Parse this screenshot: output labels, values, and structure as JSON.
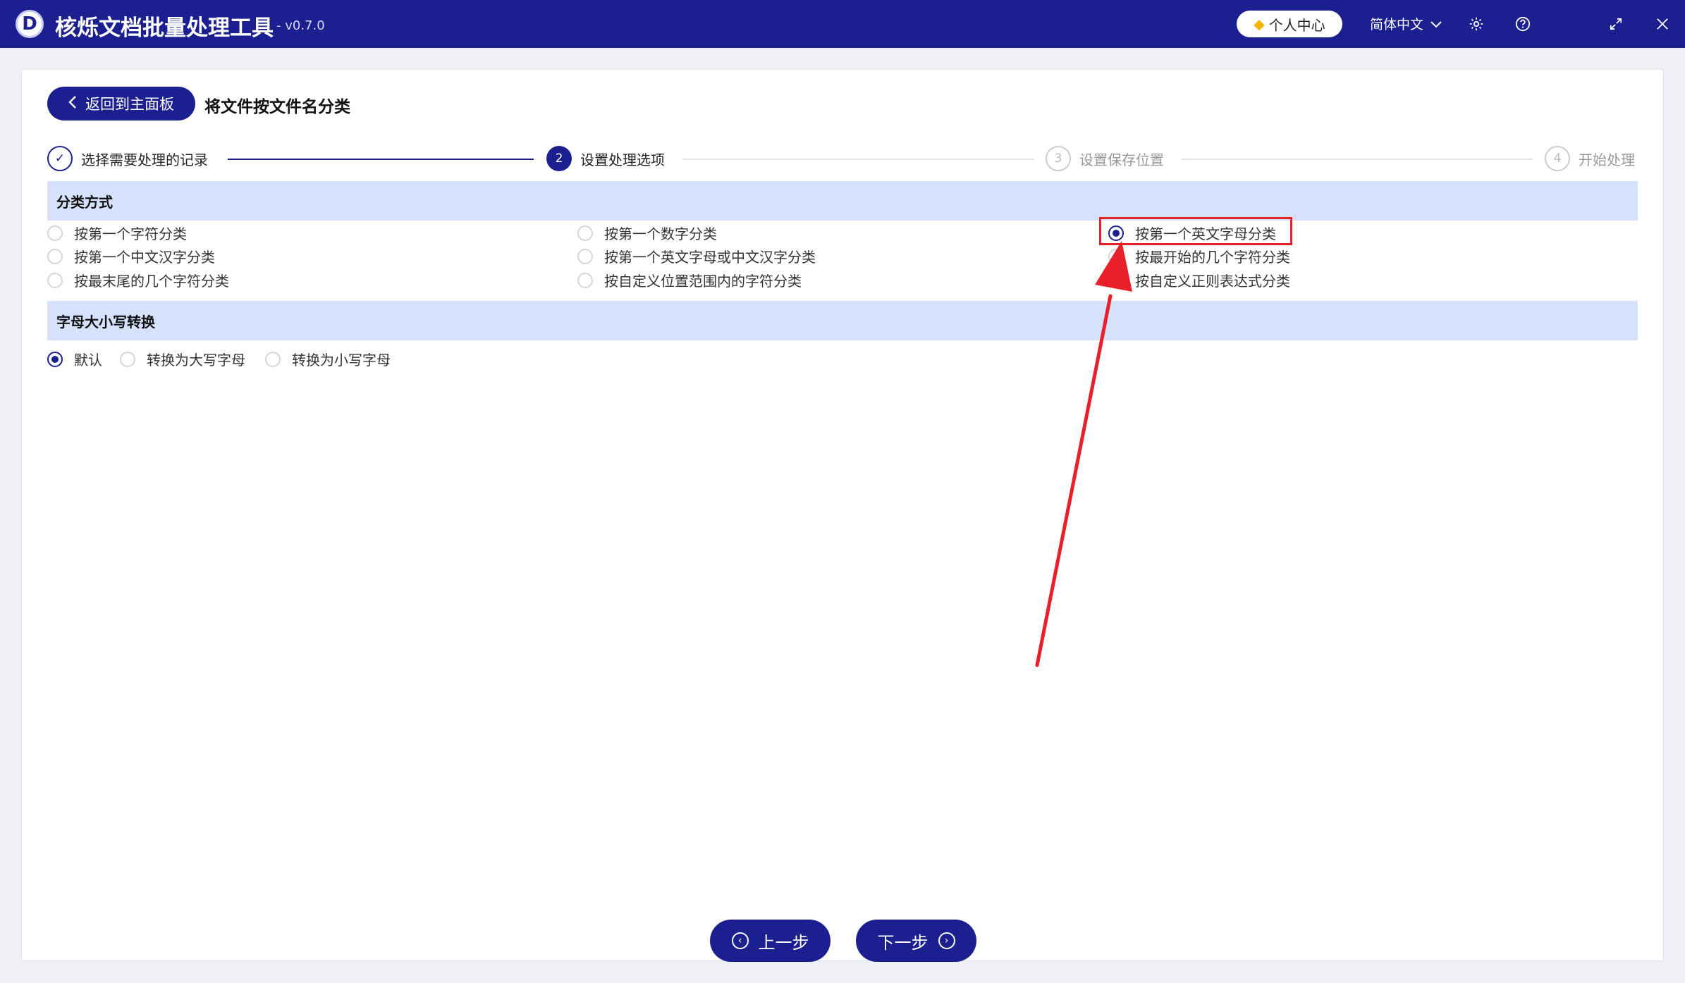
{
  "app": {
    "logo_letter": "D",
    "title": "核烁文档批量处理工具",
    "version": "- v0.7.0",
    "personal_center": "个人中心",
    "language": "简体中文"
  },
  "header": {
    "back_label": "返回到主面板",
    "page_title": "将文件按文件名分类"
  },
  "steps": [
    {
      "num": "✓",
      "label": "选择需要处理的记录",
      "state": "done"
    },
    {
      "num": "2",
      "label": "设置处理选项",
      "state": "active"
    },
    {
      "num": "3",
      "label": "设置保存位置",
      "state": "pending"
    },
    {
      "num": "4",
      "label": "开始处理",
      "state": "pending"
    }
  ],
  "classification": {
    "heading": "分类方式",
    "options": [
      {
        "label": "按第一个字符分类",
        "checked": false
      },
      {
        "label": "按第一个数字分类",
        "checked": false
      },
      {
        "label": "按第一个英文字母分类",
        "checked": true
      },
      {
        "label": "按第一个中文汉字分类",
        "checked": false
      },
      {
        "label": "按第一个英文字母或中文汉字分类",
        "checked": false
      },
      {
        "label": "按最开始的几个字符分类",
        "checked": false
      },
      {
        "label": "按最末尾的几个字符分类",
        "checked": false
      },
      {
        "label": "按自定义位置范围内的字符分类",
        "checked": false
      },
      {
        "label": "按自定义正则表达式分类",
        "checked": false
      }
    ]
  },
  "case_conversion": {
    "heading": "字母大小写转换",
    "options": [
      {
        "label": "默认",
        "checked": true
      },
      {
        "label": "转换为大写字母",
        "checked": false
      },
      {
        "label": "转换为小写字母",
        "checked": false
      }
    ]
  },
  "footer": {
    "prev_label": "上一步",
    "next_label": "下一步"
  },
  "colors": {
    "brand": "#1b1f8f",
    "section_bg": "#d6e2fb",
    "annotation_red": "#e8202a"
  }
}
